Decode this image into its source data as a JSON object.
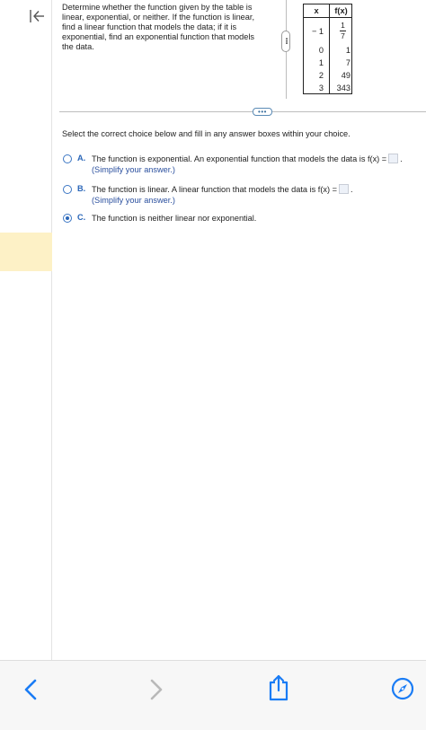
{
  "prompt": {
    "text": "Determine whether the function given by the table is linear, exponential, or neither. If the function is linear, find a linear function that models the data; if it is exponential, find an exponential function that models the data."
  },
  "table": {
    "header_x": "x",
    "header_fx": "f(x)",
    "rows": [
      {
        "x": "− 1",
        "fx_num": "1",
        "fx_den": "7"
      },
      {
        "x": "0",
        "fx": "1"
      },
      {
        "x": "1",
        "fx": "7"
      },
      {
        "x": "2",
        "fx": "49"
      },
      {
        "x": "3",
        "fx": "343"
      }
    ]
  },
  "instruction": "Select the correct choice below and fill in any answer boxes within your choice.",
  "choices": [
    {
      "letter": "A.",
      "text": "The function is exponential. An exponential function that models the data is f(x) =",
      "hint": "(Simplify your answer.)",
      "selected": false
    },
    {
      "letter": "B.",
      "text": "The function is linear. A linear function that models the data is f(x) =",
      "hint": "(Simplify your answer.)",
      "selected": false
    },
    {
      "letter": "C.",
      "text": "The function is neither linear nor exponential.",
      "selected": true
    }
  ],
  "colors": {
    "accent": "#2a66b8",
    "highlight": "#fdf1c6",
    "ios_blue": "#1a7cf5"
  },
  "bottom_bar": {
    "icons": [
      "back-icon",
      "forward-icon",
      "share-icon",
      "compass-icon"
    ]
  }
}
